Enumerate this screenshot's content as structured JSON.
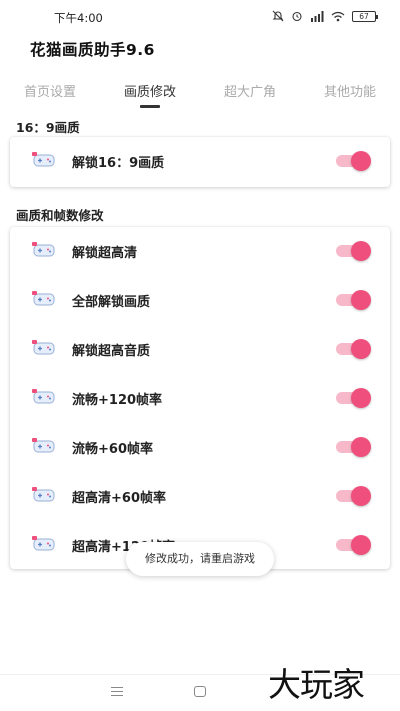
{
  "status_bar": {
    "time": "下午4:00",
    "battery": "67"
  },
  "app": {
    "title": "花猫画质助手9.6"
  },
  "tabs": [
    {
      "label": "首页设置",
      "active": false
    },
    {
      "label": "画质修改",
      "active": true
    },
    {
      "label": "超大广角",
      "active": false
    },
    {
      "label": "其他功能",
      "active": false
    }
  ],
  "sections": [
    {
      "title": "16：9画质",
      "items": [
        {
          "label": "解锁16：9画质",
          "enabled": true
        }
      ]
    },
    {
      "title": "画质和帧数修改",
      "items": [
        {
          "label": "解锁超高清",
          "enabled": true
        },
        {
          "label": "全部解锁画质",
          "enabled": true
        },
        {
          "label": "解锁超高音质",
          "enabled": true
        },
        {
          "label": "流畅+120帧率",
          "enabled": true
        },
        {
          "label": "流畅+60帧率",
          "enabled": true
        },
        {
          "label": "超高清+60帧率",
          "enabled": true
        },
        {
          "label": "超高清+120帧率",
          "enabled": true
        }
      ]
    }
  ],
  "toast": {
    "message": "修改成功，请重启游戏"
  },
  "watermark": {
    "text": "大玩家"
  },
  "colors": {
    "accent": "#ef4f7c",
    "toggle_track": "#f7b8c9"
  },
  "icons": {
    "row_icon": "gamepad-icon"
  }
}
